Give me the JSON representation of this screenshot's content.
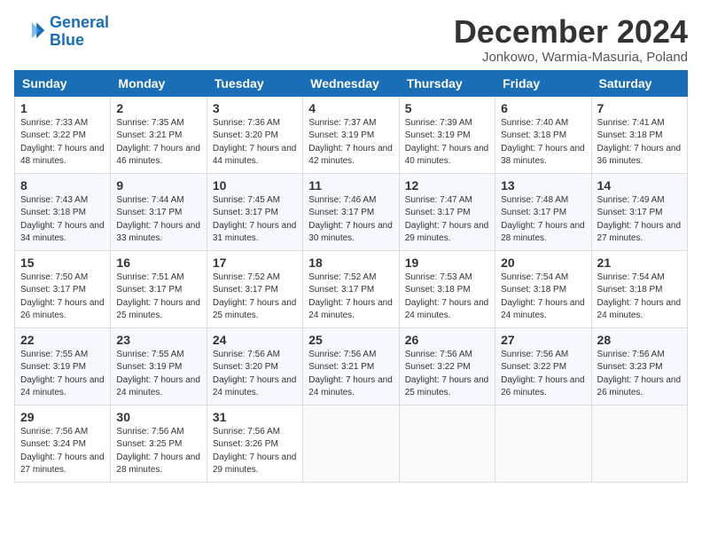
{
  "logo": {
    "line1": "General",
    "line2": "Blue"
  },
  "title": "December 2024",
  "subtitle": "Jonkowo, Warmia-Masuria, Poland",
  "headers": [
    "Sunday",
    "Monday",
    "Tuesday",
    "Wednesday",
    "Thursday",
    "Friday",
    "Saturday"
  ],
  "weeks": [
    [
      {
        "day": "1",
        "sunrise": "Sunrise: 7:33 AM",
        "sunset": "Sunset: 3:22 PM",
        "daylight": "Daylight: 7 hours and 48 minutes."
      },
      {
        "day": "2",
        "sunrise": "Sunrise: 7:35 AM",
        "sunset": "Sunset: 3:21 PM",
        "daylight": "Daylight: 7 hours and 46 minutes."
      },
      {
        "day": "3",
        "sunrise": "Sunrise: 7:36 AM",
        "sunset": "Sunset: 3:20 PM",
        "daylight": "Daylight: 7 hours and 44 minutes."
      },
      {
        "day": "4",
        "sunrise": "Sunrise: 7:37 AM",
        "sunset": "Sunset: 3:19 PM",
        "daylight": "Daylight: 7 hours and 42 minutes."
      },
      {
        "day": "5",
        "sunrise": "Sunrise: 7:39 AM",
        "sunset": "Sunset: 3:19 PM",
        "daylight": "Daylight: 7 hours and 40 minutes."
      },
      {
        "day": "6",
        "sunrise": "Sunrise: 7:40 AM",
        "sunset": "Sunset: 3:18 PM",
        "daylight": "Daylight: 7 hours and 38 minutes."
      },
      {
        "day": "7",
        "sunrise": "Sunrise: 7:41 AM",
        "sunset": "Sunset: 3:18 PM",
        "daylight": "Daylight: 7 hours and 36 minutes."
      }
    ],
    [
      {
        "day": "8",
        "sunrise": "Sunrise: 7:43 AM",
        "sunset": "Sunset: 3:18 PM",
        "daylight": "Daylight: 7 hours and 34 minutes."
      },
      {
        "day": "9",
        "sunrise": "Sunrise: 7:44 AM",
        "sunset": "Sunset: 3:17 PM",
        "daylight": "Daylight: 7 hours and 33 minutes."
      },
      {
        "day": "10",
        "sunrise": "Sunrise: 7:45 AM",
        "sunset": "Sunset: 3:17 PM",
        "daylight": "Daylight: 7 hours and 31 minutes."
      },
      {
        "day": "11",
        "sunrise": "Sunrise: 7:46 AM",
        "sunset": "Sunset: 3:17 PM",
        "daylight": "Daylight: 7 hours and 30 minutes."
      },
      {
        "day": "12",
        "sunrise": "Sunrise: 7:47 AM",
        "sunset": "Sunset: 3:17 PM",
        "daylight": "Daylight: 7 hours and 29 minutes."
      },
      {
        "day": "13",
        "sunrise": "Sunrise: 7:48 AM",
        "sunset": "Sunset: 3:17 PM",
        "daylight": "Daylight: 7 hours and 28 minutes."
      },
      {
        "day": "14",
        "sunrise": "Sunrise: 7:49 AM",
        "sunset": "Sunset: 3:17 PM",
        "daylight": "Daylight: 7 hours and 27 minutes."
      }
    ],
    [
      {
        "day": "15",
        "sunrise": "Sunrise: 7:50 AM",
        "sunset": "Sunset: 3:17 PM",
        "daylight": "Daylight: 7 hours and 26 minutes."
      },
      {
        "day": "16",
        "sunrise": "Sunrise: 7:51 AM",
        "sunset": "Sunset: 3:17 PM",
        "daylight": "Daylight: 7 hours and 25 minutes."
      },
      {
        "day": "17",
        "sunrise": "Sunrise: 7:52 AM",
        "sunset": "Sunset: 3:17 PM",
        "daylight": "Daylight: 7 hours and 25 minutes."
      },
      {
        "day": "18",
        "sunrise": "Sunrise: 7:52 AM",
        "sunset": "Sunset: 3:17 PM",
        "daylight": "Daylight: 7 hours and 24 minutes."
      },
      {
        "day": "19",
        "sunrise": "Sunrise: 7:53 AM",
        "sunset": "Sunset: 3:18 PM",
        "daylight": "Daylight: 7 hours and 24 minutes."
      },
      {
        "day": "20",
        "sunrise": "Sunrise: 7:54 AM",
        "sunset": "Sunset: 3:18 PM",
        "daylight": "Daylight: 7 hours and 24 minutes."
      },
      {
        "day": "21",
        "sunrise": "Sunrise: 7:54 AM",
        "sunset": "Sunset: 3:18 PM",
        "daylight": "Daylight: 7 hours and 24 minutes."
      }
    ],
    [
      {
        "day": "22",
        "sunrise": "Sunrise: 7:55 AM",
        "sunset": "Sunset: 3:19 PM",
        "daylight": "Daylight: 7 hours and 24 minutes."
      },
      {
        "day": "23",
        "sunrise": "Sunrise: 7:55 AM",
        "sunset": "Sunset: 3:19 PM",
        "daylight": "Daylight: 7 hours and 24 minutes."
      },
      {
        "day": "24",
        "sunrise": "Sunrise: 7:56 AM",
        "sunset": "Sunset: 3:20 PM",
        "daylight": "Daylight: 7 hours and 24 minutes."
      },
      {
        "day": "25",
        "sunrise": "Sunrise: 7:56 AM",
        "sunset": "Sunset: 3:21 PM",
        "daylight": "Daylight: 7 hours and 24 minutes."
      },
      {
        "day": "26",
        "sunrise": "Sunrise: 7:56 AM",
        "sunset": "Sunset: 3:22 PM",
        "daylight": "Daylight: 7 hours and 25 minutes."
      },
      {
        "day": "27",
        "sunrise": "Sunrise: 7:56 AM",
        "sunset": "Sunset: 3:22 PM",
        "daylight": "Daylight: 7 hours and 26 minutes."
      },
      {
        "day": "28",
        "sunrise": "Sunrise: 7:56 AM",
        "sunset": "Sunset: 3:23 PM",
        "daylight": "Daylight: 7 hours and 26 minutes."
      }
    ],
    [
      {
        "day": "29",
        "sunrise": "Sunrise: 7:56 AM",
        "sunset": "Sunset: 3:24 PM",
        "daylight": "Daylight: 7 hours and 27 minutes."
      },
      {
        "day": "30",
        "sunrise": "Sunrise: 7:56 AM",
        "sunset": "Sunset: 3:25 PM",
        "daylight": "Daylight: 7 hours and 28 minutes."
      },
      {
        "day": "31",
        "sunrise": "Sunrise: 7:56 AM",
        "sunset": "Sunset: 3:26 PM",
        "daylight": "Daylight: 7 hours and 29 minutes."
      },
      null,
      null,
      null,
      null
    ]
  ]
}
